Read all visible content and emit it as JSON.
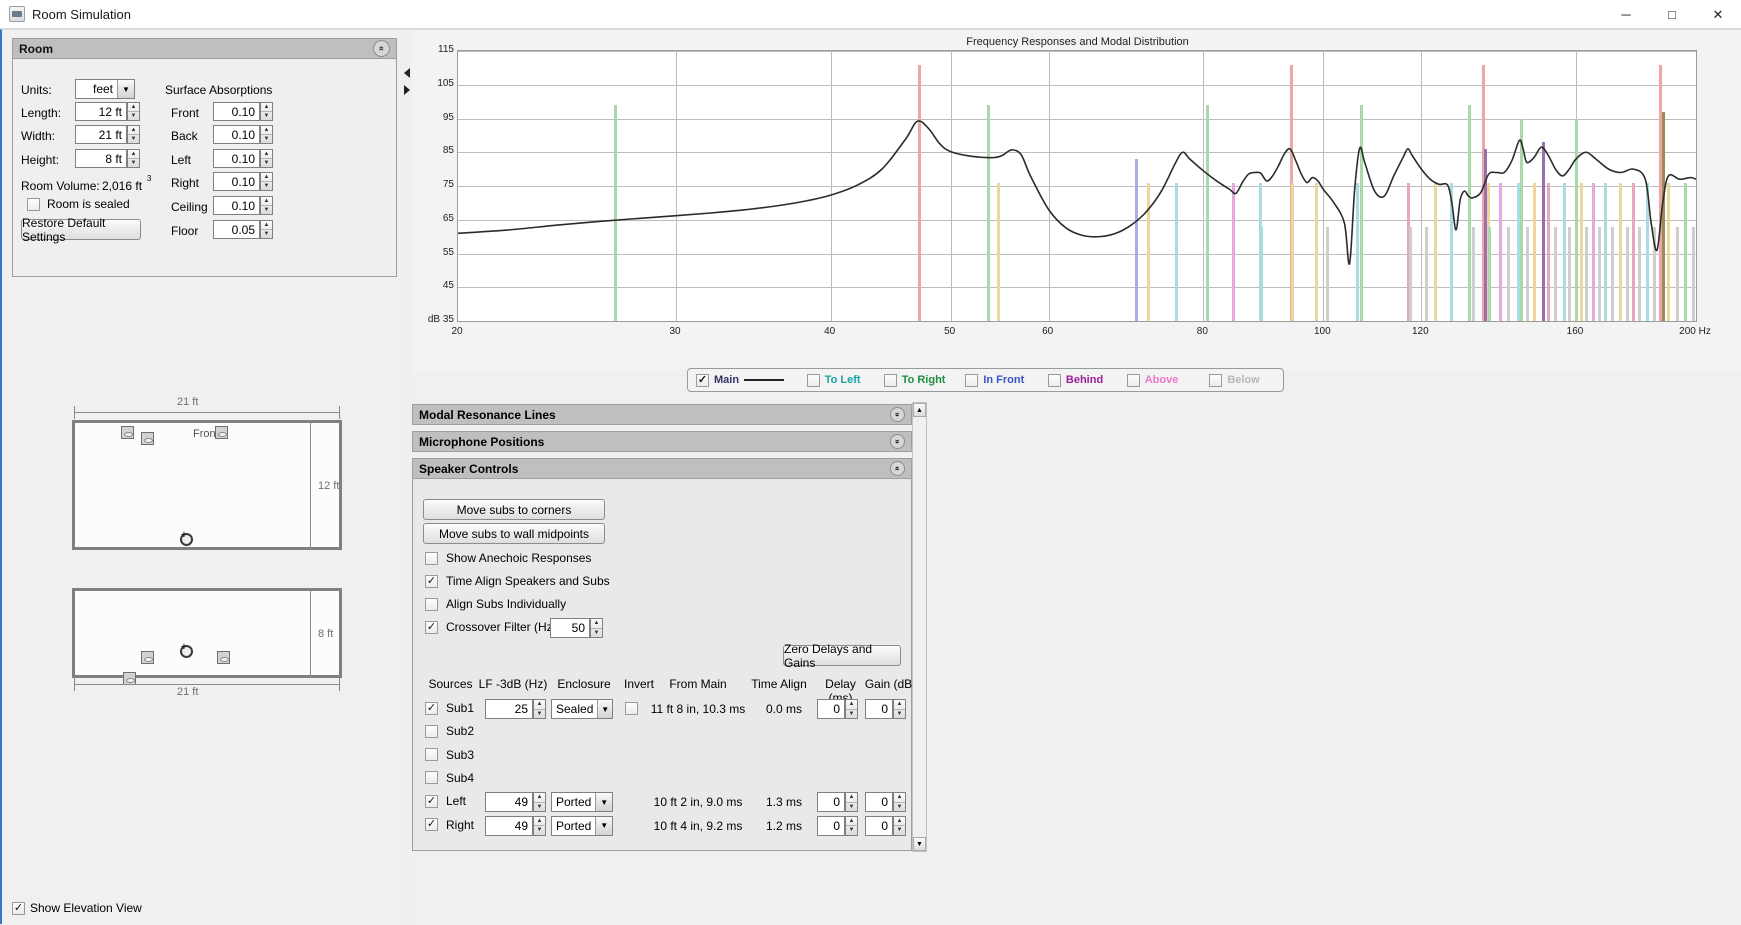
{
  "window": {
    "title": "Room Simulation",
    "icon": "java-app-icon",
    "minimize": "─",
    "maximize": "□",
    "close": "✕"
  },
  "room_panel": {
    "header": "Room",
    "collapse_icon": "«",
    "units_label": "Units:",
    "units_value": "feet",
    "length_label": "Length:",
    "length_value": "12 ft",
    "width_label": "Width:",
    "width_value": "21 ft",
    "height_label": "Height:",
    "height_value": "8 ft",
    "volume_label": "Room Volume:",
    "volume_value": "2,016 ft",
    "volume_exp": "3",
    "sealed_label": "Room is sealed",
    "sealed_checked": false,
    "restore_button": "Restore Default Settings",
    "absorptions_title": "Surface Absorptions",
    "absorptions": [
      {
        "label": "Front",
        "value": "0.10"
      },
      {
        "label": "Back",
        "value": "0.10"
      },
      {
        "label": "Left",
        "value": "0.10"
      },
      {
        "label": "Right",
        "value": "0.10"
      },
      {
        "label": "Ceiling",
        "value": "0.10"
      },
      {
        "label": "Floor",
        "value": "0.05"
      }
    ]
  },
  "diagrams": {
    "plan_width_label": "21 ft",
    "plan_depth_label": "12 ft",
    "front_label": "Front",
    "elev_width_label": "21 ft",
    "elev_height_label": "8 ft",
    "show_elevation_label": "Show Elevation View",
    "show_elevation_checked": true
  },
  "chart_data": {
    "type": "line",
    "title": "Frequency Responses and Modal Distribution",
    "xlabel": "Hz",
    "ylabel": "dB",
    "ylim": [
      35,
      115
    ],
    "xlim": [
      20,
      200
    ],
    "xscale": "log",
    "yticks": [
      35,
      45,
      55,
      65,
      75,
      85,
      95,
      105,
      115
    ],
    "xticks": [
      20,
      30,
      40,
      50,
      60,
      80,
      100,
      120,
      160,
      200
    ],
    "y_axis_unit_label": "dB 35",
    "x_axis_unit_label": "200 Hz",
    "grid": true,
    "series": [
      {
        "name": "Main",
        "color": "#2b2b2b",
        "points": [
          [
            20,
            61
          ],
          [
            22,
            62
          ],
          [
            24,
            63.4
          ],
          [
            26,
            64.5
          ],
          [
            28,
            65.4
          ],
          [
            30,
            66.2
          ],
          [
            32,
            67.0
          ],
          [
            34,
            67.9
          ],
          [
            36,
            69.0
          ],
          [
            38,
            70.4
          ],
          [
            40,
            72.3
          ],
          [
            42,
            75.2
          ],
          [
            44,
            80.0
          ],
          [
            46,
            89.0
          ],
          [
            47,
            94.2
          ],
          [
            48,
            92.0
          ],
          [
            49,
            87.5
          ],
          [
            50,
            85.2
          ],
          [
            52,
            83.8
          ],
          [
            54,
            83.4
          ],
          [
            55,
            84.0
          ],
          [
            56,
            85.7
          ],
          [
            57,
            84.3
          ],
          [
            58,
            78.0
          ],
          [
            60,
            68.0
          ],
          [
            62,
            62.5
          ],
          [
            64,
            60.3
          ],
          [
            66,
            60.0
          ],
          [
            68,
            61.0
          ],
          [
            70,
            63.5
          ],
          [
            72,
            67.5
          ],
          [
            74,
            73.5
          ],
          [
            76,
            82.0
          ],
          [
            77,
            85.0
          ],
          [
            78,
            83.0
          ],
          [
            80,
            79.5
          ],
          [
            82,
            76.5
          ],
          [
            84,
            74.0
          ],
          [
            85,
            72.8
          ],
          [
            86,
            76.0
          ],
          [
            87,
            78.5
          ],
          [
            88,
            79.0
          ],
          [
            89,
            78.8
          ],
          [
            90,
            76.5
          ],
          [
            91,
            78.0
          ],
          [
            92,
            81.0
          ],
          [
            93,
            84.5
          ],
          [
            94,
            86.0
          ],
          [
            95,
            82.5
          ],
          [
            96,
            78.5
          ],
          [
            97,
            76.0
          ],
          [
            98,
            77.5
          ],
          [
            99,
            76.5
          ],
          [
            100,
            74.0
          ],
          [
            102,
            70.0
          ],
          [
            104,
            64.0
          ],
          [
            105,
            52.0
          ],
          [
            106,
            74.0
          ],
          [
            107,
            86.2
          ],
          [
            108,
            82.0
          ],
          [
            110,
            73.5
          ],
          [
            112,
            72.0
          ],
          [
            114,
            78.0
          ],
          [
            116,
            83.5
          ],
          [
            117,
            86.0
          ],
          [
            118,
            84.0
          ],
          [
            120,
            80.0
          ],
          [
            122,
            77.0
          ],
          [
            124,
            75.5
          ],
          [
            126,
            75.3
          ],
          [
            127,
            70.0
          ],
          [
            128,
            62.0
          ],
          [
            129,
            71.0
          ],
          [
            130,
            73.5
          ],
          [
            131,
            72.0
          ],
          [
            132,
            71.5
          ],
          [
            134,
            73.0
          ],
          [
            136,
            78.5
          ],
          [
            138,
            79.0
          ],
          [
            140,
            79.0
          ],
          [
            142,
            82.5
          ],
          [
            144,
            88.5
          ],
          [
            145,
            86.0
          ],
          [
            146,
            82.0
          ],
          [
            148,
            83.5
          ],
          [
            150,
            86.5
          ],
          [
            152,
            84.0
          ],
          [
            154,
            80.0
          ],
          [
            156,
            78.0
          ],
          [
            158,
            80.0
          ],
          [
            160,
            83.0
          ],
          [
            163,
            85.0
          ],
          [
            166,
            83.0
          ],
          [
            170,
            80.0
          ],
          [
            174,
            79.0
          ],
          [
            178,
            80.0
          ],
          [
            182,
            77.0
          ],
          [
            184,
            64.0
          ],
          [
            186,
            56.0
          ],
          [
            188,
            70.0
          ],
          [
            190,
            78.0
          ],
          [
            194,
            77.0
          ],
          [
            198,
            77.5
          ],
          [
            200,
            77.0
          ]
        ]
      }
    ],
    "modal_lines": [
      {
        "freq": 26.8,
        "top": 99,
        "color": "#a9d9a9"
      },
      {
        "freq": 47.1,
        "top": 111,
        "color": "#eda6a6"
      },
      {
        "freq": 53.6,
        "top": 99,
        "color": "#a9d9a9"
      },
      {
        "freq": 54.6,
        "top": 76,
        "color": "#ebd79a"
      },
      {
        "freq": 70.6,
        "top": 83,
        "color": "#a8aede"
      },
      {
        "freq": 72.2,
        "top": 76,
        "color": "#ebd79a"
      },
      {
        "freq": 76.0,
        "top": 76,
        "color": "#a9dde0"
      },
      {
        "freq": 80.5,
        "top": 99,
        "color": "#a9d9a9"
      },
      {
        "freq": 84.5,
        "top": 76,
        "color": "#e6a9dd"
      },
      {
        "freq": 88.9,
        "top": 76,
        "color": "#a9dde0"
      },
      {
        "freq": 89.0,
        "top": 63,
        "color": "#a9dde0"
      },
      {
        "freq": 94.2,
        "top": 111,
        "color": "#eda6a6"
      },
      {
        "freq": 94.4,
        "top": 76,
        "color": "#ebd79a"
      },
      {
        "freq": 98.6,
        "top": 76,
        "color": "#ebd79a"
      },
      {
        "freq": 100.6,
        "top": 63,
        "color": "#cfcfcf"
      },
      {
        "freq": 106.5,
        "top": 76,
        "color": "#a9dde0"
      },
      {
        "freq": 107.2,
        "top": 99,
        "color": "#a9d9a9"
      },
      {
        "freq": 117.0,
        "top": 76,
        "color": "#e8a7c0"
      },
      {
        "freq": 117.5,
        "top": 63,
        "color": "#cfcfcf"
      },
      {
        "freq": 121.0,
        "top": 63,
        "color": "#cfcfcf"
      },
      {
        "freq": 123.0,
        "top": 76,
        "color": "#ebd79a"
      },
      {
        "freq": 126.8,
        "top": 76,
        "color": "#a9dde0"
      },
      {
        "freq": 131.0,
        "top": 99,
        "color": "#a9d9a9"
      },
      {
        "freq": 132.0,
        "top": 63,
        "color": "#cfcfcf"
      },
      {
        "freq": 134.5,
        "top": 111,
        "color": "#eda6a6"
      },
      {
        "freq": 135.0,
        "top": 86,
        "color": "#9a6fb0"
      },
      {
        "freq": 135.8,
        "top": 76,
        "color": "#ebd79a"
      },
      {
        "freq": 136.2,
        "top": 63,
        "color": "#a9d9a9"
      },
      {
        "freq": 139.0,
        "top": 76,
        "color": "#e6a9dd"
      },
      {
        "freq": 141.0,
        "top": 63,
        "color": "#cfcfcf"
      },
      {
        "freq": 143.5,
        "top": 76,
        "color": "#a9dde0"
      },
      {
        "freq": 144.5,
        "top": 95,
        "color": "#a9d9a9"
      },
      {
        "freq": 146.0,
        "top": 63,
        "color": "#cfcfcf"
      },
      {
        "freq": 148.0,
        "top": 76,
        "color": "#ebd79a"
      },
      {
        "freq": 150.5,
        "top": 88,
        "color": "#9a6fb0"
      },
      {
        "freq": 152.0,
        "top": 76,
        "color": "#e8a7c0"
      },
      {
        "freq": 154.0,
        "top": 63,
        "color": "#cfcfcf"
      },
      {
        "freq": 156.5,
        "top": 76,
        "color": "#a9dde0"
      },
      {
        "freq": 158.0,
        "top": 63,
        "color": "#cfcfcf"
      },
      {
        "freq": 160.0,
        "top": 95,
        "color": "#a9d9a9"
      },
      {
        "freq": 161.5,
        "top": 76,
        "color": "#ebd79a"
      },
      {
        "freq": 163.0,
        "top": 63,
        "color": "#cfcfcf"
      },
      {
        "freq": 165.0,
        "top": 76,
        "color": "#e6a9dd"
      },
      {
        "freq": 167.0,
        "top": 63,
        "color": "#cfcfcf"
      },
      {
        "freq": 169.0,
        "top": 76,
        "color": "#a9dde0"
      },
      {
        "freq": 171.0,
        "top": 63,
        "color": "#cfcfcf"
      },
      {
        "freq": 173.5,
        "top": 76,
        "color": "#ebd79a"
      },
      {
        "freq": 176.0,
        "top": 63,
        "color": "#cfcfcf"
      },
      {
        "freq": 178.0,
        "top": 76,
        "color": "#e8a7c0"
      },
      {
        "freq": 180.0,
        "top": 63,
        "color": "#cfcfcf"
      },
      {
        "freq": 182.5,
        "top": 76,
        "color": "#a9dde0"
      },
      {
        "freq": 185.0,
        "top": 63,
        "color": "#cfcfcf"
      },
      {
        "freq": 187.0,
        "top": 111,
        "color": "#eda6a6"
      },
      {
        "freq": 188.0,
        "top": 97,
        "color": "#9a8b5a"
      },
      {
        "freq": 190.0,
        "top": 76,
        "color": "#ebd79a"
      },
      {
        "freq": 193.0,
        "top": 63,
        "color": "#cfcfcf"
      },
      {
        "freq": 196.0,
        "top": 76,
        "color": "#a9d9a9"
      },
      {
        "freq": 199.0,
        "top": 63,
        "color": "#cfcfcf"
      }
    ],
    "legend": [
      {
        "label": "Main",
        "checked": true,
        "color": "#333366",
        "line": true
      },
      {
        "label": "To Left",
        "checked": false,
        "color": "#1aa3a3",
        "line": false
      },
      {
        "label": "To Right",
        "checked": false,
        "color": "#1f8f3f",
        "line": false
      },
      {
        "label": "In Front",
        "checked": false,
        "color": "#3a52c8",
        "line": false
      },
      {
        "label": "Behind",
        "checked": false,
        "color": "#9b1f9b",
        "line": false
      },
      {
        "label": "Above",
        "checked": false,
        "color": "#ee77cc",
        "line": false
      },
      {
        "label": "Below",
        "checked": false,
        "color": "#b8b8b8",
        "line": false
      }
    ]
  },
  "panels": {
    "modal_resonance": "Modal Resonance Lines",
    "microphone_positions": "Microphone Positions",
    "speaker_controls": "Speaker Controls",
    "expand_icon": "»",
    "collapse_icon": "«"
  },
  "speaker_controls": {
    "move_corners": "Move subs to corners",
    "move_midpoints": "Move subs to wall midpoints",
    "show_anechoic": {
      "label": "Show Anechoic Responses",
      "checked": false
    },
    "time_align": {
      "label": "Time Align Speakers and Subs",
      "checked": true
    },
    "align_individually": {
      "label": "Align Subs Individually",
      "checked": false
    },
    "crossover": {
      "label": "Crossover Filter (Hz)",
      "checked": true,
      "value": "50"
    },
    "zero_delays": "Zero Delays and Gains",
    "columns": [
      "Sources",
      "LF -3dB (Hz)",
      "Enclosure",
      "Invert",
      "From Main",
      "Time Align",
      "Delay (ms)",
      "Gain (dB)"
    ],
    "rows": [
      {
        "name": "Sub1",
        "checked": true,
        "lf": "25",
        "enclosure": "Sealed",
        "invert": false,
        "from_main": "11 ft 8 in, 10.3 ms",
        "time_align": "0.0 ms",
        "delay": "0",
        "gain": "0",
        "full": true
      },
      {
        "name": "Sub2",
        "checked": false,
        "lf": "",
        "enclosure": "",
        "invert": null,
        "from_main": "",
        "time_align": "",
        "delay": "",
        "gain": "",
        "full": false
      },
      {
        "name": "Sub3",
        "checked": false,
        "lf": "",
        "enclosure": "",
        "invert": null,
        "from_main": "",
        "time_align": "",
        "delay": "",
        "gain": "",
        "full": false
      },
      {
        "name": "Sub4",
        "checked": false,
        "lf": "",
        "enclosure": "",
        "invert": null,
        "from_main": "",
        "time_align": "",
        "delay": "",
        "gain": "",
        "full": false
      },
      {
        "name": "Left",
        "checked": true,
        "lf": "49",
        "enclosure": "Ported",
        "invert": null,
        "from_main": "10 ft 2 in, 9.0 ms",
        "time_align": "1.3 ms",
        "delay": "0",
        "gain": "0",
        "full": true
      },
      {
        "name": "Right",
        "checked": true,
        "lf": "49",
        "enclosure": "Ported",
        "invert": null,
        "from_main": "10 ft 4 in, 9.2 ms",
        "time_align": "1.2 ms",
        "delay": "0",
        "gain": "0",
        "full": true
      }
    ]
  }
}
